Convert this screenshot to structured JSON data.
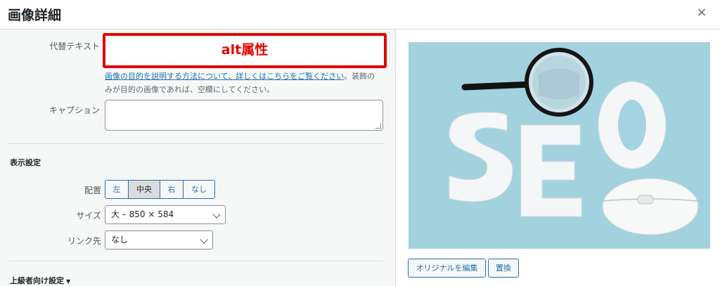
{
  "header": {
    "title": "画像詳細",
    "close_icon": "×"
  },
  "fields": {
    "alt_label": "代替テキスト",
    "alt_value": "alt属性",
    "alt_help_link": "画像の目的を説明する方法について、詳しくはこちらをご覧ください",
    "alt_help_rest": "。装飾のみが目的の画像であれば、空欄にしてください。",
    "caption_label": "キャプション",
    "caption_value": ""
  },
  "display_settings": {
    "title": "表示設定",
    "align_label": "配置",
    "align_options": [
      "左",
      "中央",
      "右",
      "なし"
    ],
    "align_selected": "中央",
    "size_label": "サイズ",
    "size_value": "大 – 850 × 584",
    "link_label": "リンク先",
    "link_value": "なし"
  },
  "advanced": {
    "label": "上級者向け設定",
    "toggle_icon": "▼"
  },
  "preview": {
    "edit_original_label": "オリジナルを編集",
    "replace_label": "置換"
  },
  "colors": {
    "highlight_red": "#e10600",
    "link_blue": "#2271b1",
    "image_bg": "#a4d4e1"
  }
}
